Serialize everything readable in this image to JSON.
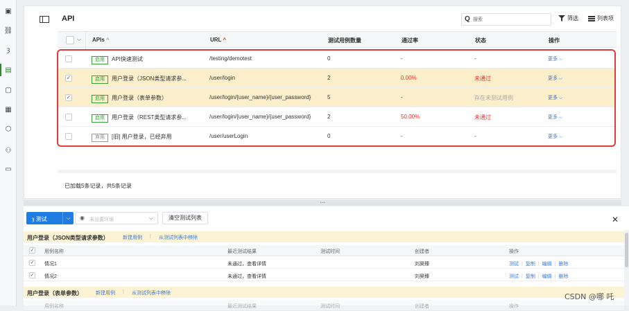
{
  "toolbar": {
    "title": "API",
    "search_placeholder": "搜索",
    "filter_label": "筛选",
    "columns_label": "列表项"
  },
  "table": {
    "headers": {
      "name": "APIs",
      "url": "URL",
      "cases": "测试用例数量",
      "pass_rate": "通过率",
      "status": "状态",
      "actions": "操作"
    },
    "rows": [
      {
        "checked": false,
        "badge": "启用",
        "name": "API快速测试",
        "url": "/testing/demotest",
        "cases": "0",
        "pass_rate": "-",
        "status": "-",
        "more": "更多"
      },
      {
        "checked": true,
        "badge": "启用",
        "name": "用户登录（JSON类型请求参...",
        "url": "/user/login",
        "cases": "2",
        "pass_rate": "0.00%",
        "status": "未通过",
        "more": "更多"
      },
      {
        "checked": true,
        "badge": "启用",
        "name": "用户登录（表单参数）",
        "url": "/user/login/{user_name}/{user_password}",
        "cases": "5",
        "pass_rate": "-",
        "status": "存在未测试用例",
        "more": "更多"
      },
      {
        "checked": false,
        "badge": "启用",
        "name": "用户登录（REST类型请求参...",
        "url": "/user/login/{user_name}/{user_password}",
        "cases": "2",
        "pass_rate": "50.00%",
        "status": "未通过",
        "more": "更多"
      },
      {
        "checked": false,
        "badge": "弃用",
        "name": "[旧] 用户登录，已经弃用",
        "url": "/user/userLogin",
        "cases": "0",
        "pass_rate": "-",
        "status": "-",
        "more": "更多"
      }
    ],
    "footer": "已加载5条记录，共5条记录"
  },
  "bottom": {
    "test_label": "测试",
    "env_placeholder": "未设置环境",
    "clear_label": "清空测试列表",
    "groups": [
      {
        "title": "用户登录（JSON类型请求参数）",
        "new_case": "新建用例",
        "remove": "从测试列表中移除",
        "columns": {
          "name": "用例名称",
          "result": "最近测试结果",
          "time": "测试时间",
          "creator": "创建者",
          "ops": "操作"
        },
        "cases": [
          {
            "checked": true,
            "name": "情况1",
            "result": "未通过，查看详情",
            "time": "",
            "creator": "刘昊臻",
            "ops": [
              "测试",
              "复制",
              "编辑",
              "删除"
            ]
          },
          {
            "checked": true,
            "name": "情况2",
            "result": "未通过，查看详情",
            "time": "",
            "creator": "刘昊臻",
            "ops": [
              "测试",
              "复制",
              "编辑",
              "删除"
            ]
          }
        ]
      },
      {
        "title": "用户登录（表单参数）",
        "new_case": "新建用例",
        "remove": "从测试列表中移除",
        "columns": {
          "name": "用例名称",
          "result": "最近测试结果",
          "time": "测试时间",
          "creator": "创建者",
          "ops": "操作"
        },
        "cases": []
      }
    ]
  },
  "watermark": "CSDN @哪 吒",
  "colors": {
    "accent": "#1f7ce0",
    "selected_row": "#fbeecb",
    "fail": "#e0322d",
    "enabled": "#3aa03a",
    "highlight": "#e03b3b"
  }
}
